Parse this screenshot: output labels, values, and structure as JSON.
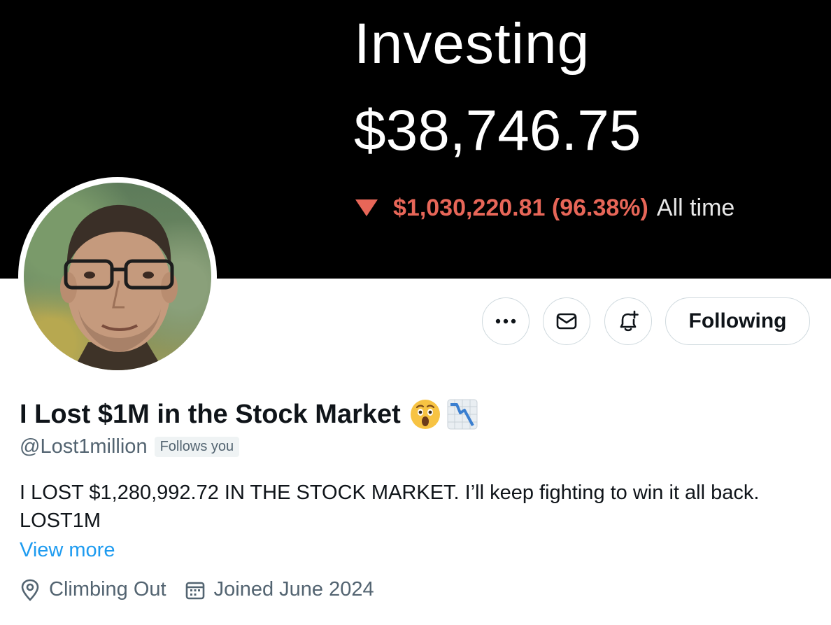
{
  "banner": {
    "title": "Investing",
    "value": "$38,746.75",
    "change": "$1,030,220.81 (96.38%)",
    "change_suffix": "All time",
    "change_color": "#e76658"
  },
  "actions": {
    "more_icon": "more-dots-icon",
    "message_icon": "envelope-icon",
    "notify_icon": "bell-plus-icon",
    "follow_label": "Following"
  },
  "profile": {
    "display_name": "I Lost $1M in the Stock Market",
    "name_emojis": [
      "😲",
      "📉"
    ],
    "handle": "@Lost1million",
    "follows_you": "Follows you",
    "bio": "I LOST $1,280,992.72 IN THE STOCK MARKET. I’ll keep fighting to win it all back. LOST1M",
    "view_more": "View more",
    "location": "Climbing Out",
    "joined": "Joined June 2024"
  },
  "colors": {
    "link": "#1d9bf0",
    "secondary_text": "#536471",
    "border": "#cfd9de"
  }
}
